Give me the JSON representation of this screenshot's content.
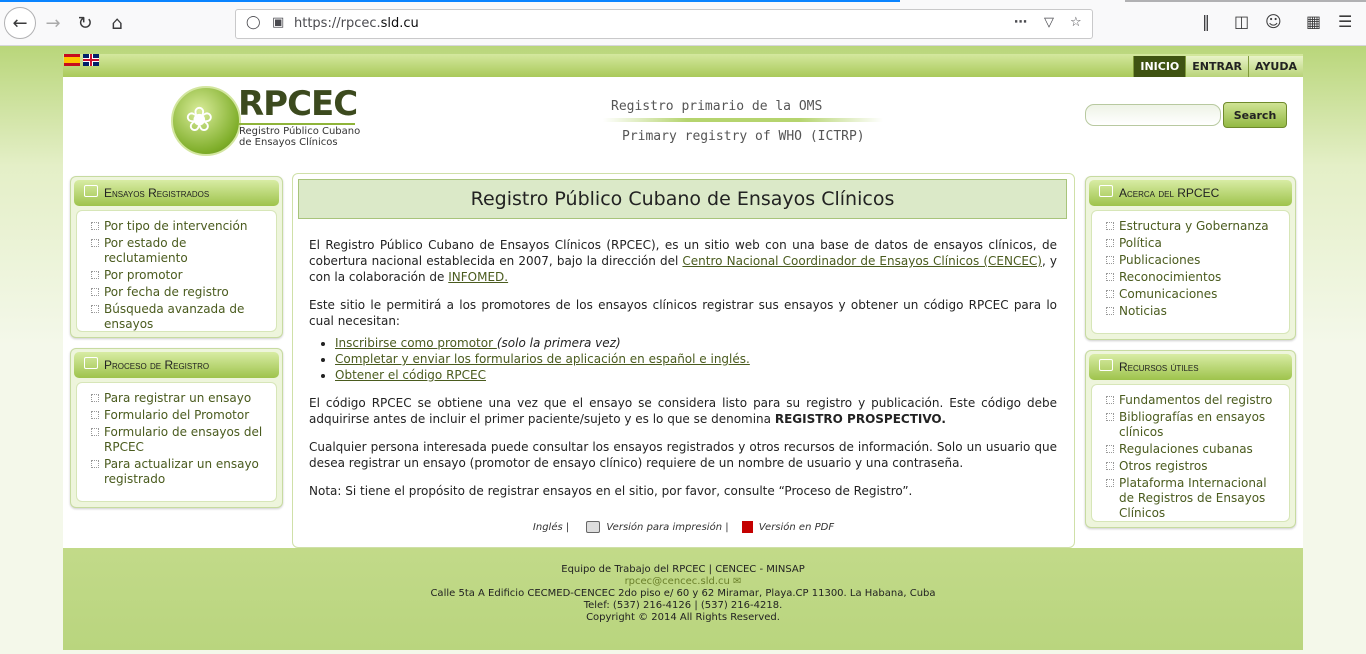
{
  "browser": {
    "url_prefix": "https://rpcec.",
    "url_domain": "sld.cu",
    "icons": [
      "back-icon",
      "forward-icon",
      "reload-icon",
      "home-icon",
      "shield-icon",
      "lock-icon",
      "more-icon",
      "pocket-icon",
      "star-icon",
      "library-icon",
      "sidebar-icon",
      "account-icon",
      "extensions-icon",
      "menu-icon"
    ]
  },
  "topnav": {
    "inicio": "INICIO",
    "entrar": "ENTRAR",
    "ayuda": "AYUDA"
  },
  "header": {
    "logo_title": "RPCEC",
    "logo_sub1": "Registro Público Cubano",
    "logo_sub2": "de Ensayos Clínicos",
    "who_es": "Registro primario de la OMS",
    "who_en": "Primary registry of WHO (ICTRP)",
    "search_button": "Search",
    "search_placeholder": ""
  },
  "left": {
    "ensayos": {
      "title": "Ensayos Registrados",
      "items": [
        "Por tipo de intervención",
        "Por estado de reclutamiento",
        "Por promotor",
        "Por fecha de registro",
        "Búsqueda avanzada de ensayos"
      ]
    },
    "proceso": {
      "title": "Proceso de Registro",
      "items": [
        "Para registrar un ensayo",
        "Formulario del Promotor",
        "Formulario de ensayos del RPCEC",
        "Para actualizar un ensayo registrado"
      ]
    }
  },
  "right": {
    "acerca": {
      "title": "Acerca del RPCEC",
      "items": [
        "Estructura y Gobernanza",
        "Política",
        "Publicaciones",
        "Reconocimientos",
        "Comunicaciones",
        "Noticias"
      ]
    },
    "recursos": {
      "title": "Recursos útiles",
      "items": [
        "Fundamentos del registro",
        "Bibliografías en ensayos clínicos",
        "Regulaciones cubanas",
        "Otros registros",
        "Plataforma Internacional de Registros de Ensayos Clínicos"
      ]
    }
  },
  "main": {
    "title": "Registro Público Cubano de Ensayos Clínicos",
    "p1_a": "El Registro Público Cubano de Ensayos Clínicos (RPCEC), es un sitio web con una base de datos de ensayos clínicos, de cobertura nacional establecida en 2007, bajo la dirección del ",
    "p1_link1": "Centro Nacional Coordinador de Ensayos Clínicos (CENCEC)",
    "p1_b": ", y con la colaboración de ",
    "p1_link2": "INFOMED.",
    "p2": "Este sitio le permitirá a los promotores de los ensayos clínicos registrar sus ensayos y obtener un código RPCEC para lo cual necesitan:",
    "steps": [
      {
        "link": "Inscribirse como promotor ",
        "note": "(solo la primera vez)"
      },
      {
        "link": "Completar y enviar los formularios de aplicación en español e inglés.",
        "note": ""
      },
      {
        "link": "Obtener el código RPCEC",
        "note": ""
      }
    ],
    "p3_a": "El código RPCEC se obtiene una vez que el ensayo se considera listo para su registro y publicación. Este código debe adquirirse antes de incluir el primer paciente/sujeto y es lo que se denomina ",
    "p3_bold": "REGISTRO PROSPECTIVO.",
    "p4": "Cualquier persona interesada puede consultar los ensayos registrados y otros recursos de información. Solo un usuario que desea registrar un ensayo (promotor de ensayo clínico) requiere de un nombre de usuario y una contraseña.",
    "p5": "Nota: Si tiene el propósito de registrar ensayos en el sitio, por favor, consulte “Proceso de Registro”.",
    "footer_ingles": "Inglés |",
    "footer_print": "Versión para impresión |",
    "footer_pdf": "Versión en PDF"
  },
  "footer": {
    "line1": "Equipo de Trabajo del RPCEC | CENCEC - MINSAP",
    "email": "rpcec@cencec.sld.cu",
    "line3": "Calle 5ta A Edificio CECMED-CENCEC 2do piso e/ 60 y 62 Miramar, Playa.CP 11300. La Habana, Cuba",
    "line4": "Telef: (537) 216-4126 | (537) 216-4218.",
    "line5": "Copyright © 2014 All Rights Reserved."
  }
}
